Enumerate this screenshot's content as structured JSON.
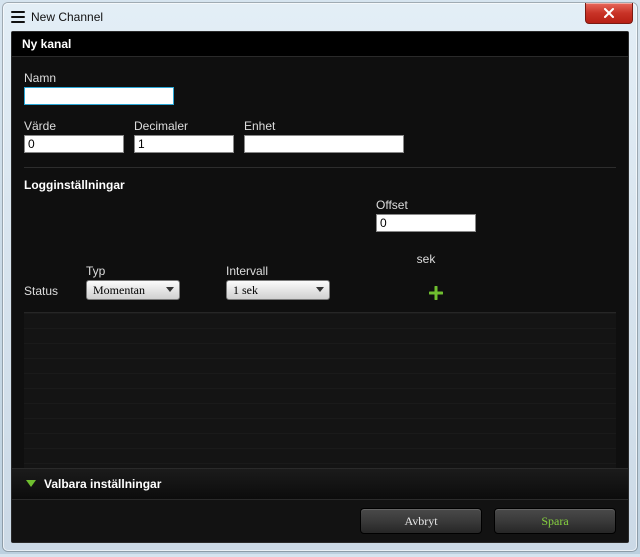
{
  "window": {
    "title": "New Channel"
  },
  "header": {
    "title": "Ny kanal"
  },
  "form": {
    "name": {
      "label": "Namn",
      "value": ""
    },
    "value": {
      "label": "Värde",
      "value": "0"
    },
    "decimals": {
      "label": "Decimaler",
      "value": "1"
    },
    "unit": {
      "label": "Enhet",
      "value": ""
    }
  },
  "log": {
    "title": "Logginställningar",
    "status_label": "Status",
    "type": {
      "label": "Typ",
      "selected": "Momentan"
    },
    "interval": {
      "label": "Intervall",
      "selected": "1 sek"
    },
    "offset": {
      "label": "Offset",
      "value": "0",
      "unit": "sek"
    }
  },
  "optional": {
    "label": "Valbara inställningar"
  },
  "footer": {
    "cancel": "Avbryt",
    "save": "Spara"
  },
  "colors": {
    "accent": "#86d13f",
    "focus": "#2aa7d6"
  }
}
